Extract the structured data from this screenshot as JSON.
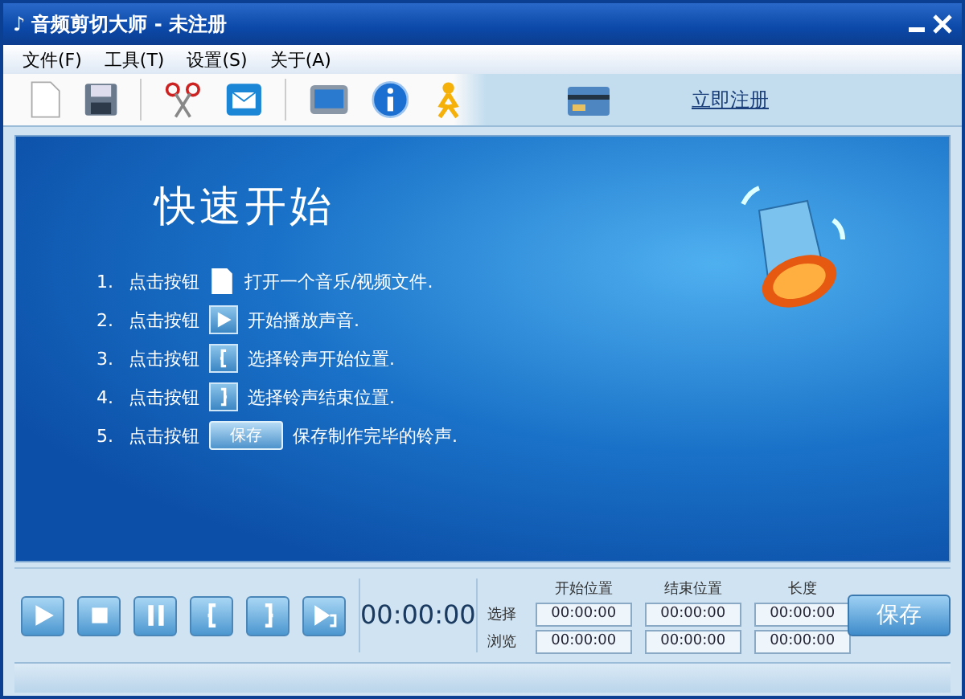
{
  "window": {
    "icon": "♪",
    "title": "音频剪切大师 - 未注册"
  },
  "menu": [
    "文件(F)",
    "工具(T)",
    "设置(S)",
    "关于(A)"
  ],
  "toolbar": {
    "tools": [
      {
        "kind": "new"
      },
      {
        "kind": "save"
      },
      {
        "kind": "sep"
      },
      {
        "kind": "cut"
      },
      {
        "kind": "mail"
      },
      {
        "kind": "sep"
      },
      {
        "kind": "screen"
      },
      {
        "kind": "info"
      },
      {
        "kind": "person"
      }
    ],
    "register_link": "立即注册"
  },
  "intro": {
    "heading": "快速开始",
    "steps": [
      {
        "number": "1.",
        "prefix": "点击按钮",
        "kind": "open",
        "text": "打开一个音乐/视频文件."
      },
      {
        "number": "2.",
        "prefix": "点击按钮",
        "kind": "play",
        "text": "开始播放声音."
      },
      {
        "number": "3.",
        "prefix": "点击按钮",
        "kind": "start",
        "text": "选择铃声开始位置."
      },
      {
        "number": "4.",
        "prefix": "点击按钮",
        "kind": "end",
        "text": "选择铃声结束位置."
      },
      {
        "number": "5.",
        "prefix": "点击按钮",
        "kind": "save",
        "button_label": "保存",
        "text": "保存制作完毕的铃声."
      }
    ]
  },
  "controls": {
    "buttons": [
      {
        "kind": "play"
      },
      {
        "kind": "stop"
      },
      {
        "kind": "pause"
      },
      {
        "kind": "start"
      },
      {
        "kind": "end"
      },
      {
        "kind": "play-range"
      }
    ],
    "time": "00:00:00",
    "columns": [
      "开始位置",
      "结束位置",
      "长度"
    ],
    "rows": [
      {
        "label": "选择",
        "values": [
          "00:00:00",
          "00:00:00",
          "00:00:00"
        ]
      },
      {
        "label": "浏览",
        "values": [
          "00:00:00",
          "00:00:00",
          "00:00:00"
        ]
      }
    ],
    "save_button": "保存"
  }
}
